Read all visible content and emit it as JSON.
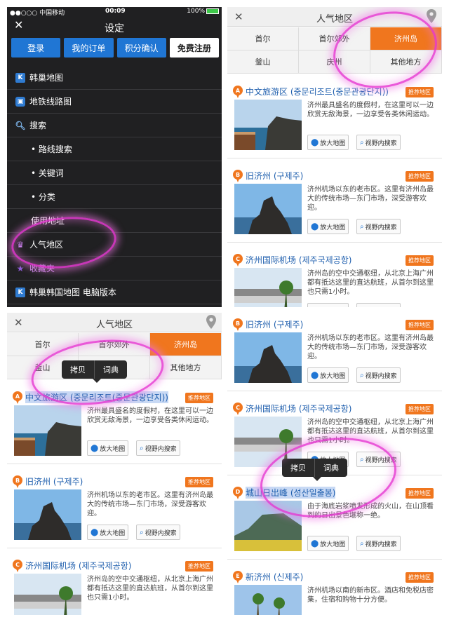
{
  "colors": {
    "accent": "#f0761e",
    "primary_button": "#2076d4",
    "link": "#1f5fae",
    "highlight": "#e63cd2"
  },
  "menu_screen": {
    "status": {
      "carrier": "●●○○○ 中国移动",
      "time": "00:09",
      "battery": "100%"
    },
    "title": "设定",
    "buttons": [
      "登录",
      "我的订单",
      "积分确认",
      "免费注册"
    ],
    "items": [
      {
        "label": "韩巢地图",
        "icon": "k-logo-icon"
      },
      {
        "label": "地铁线路图",
        "icon": "subway-icon"
      },
      {
        "label": "搜索",
        "icon": "search-icon"
      },
      {
        "label": "• 路线搜索",
        "icon": ""
      },
      {
        "label": "• 关键词",
        "icon": ""
      },
      {
        "label": "• 分类",
        "icon": ""
      },
      {
        "label": "使用地址",
        "icon": ""
      },
      {
        "label": "人气地区",
        "icon": "crown-icon"
      },
      {
        "label": "收藏夹",
        "icon": "star-icon"
      },
      {
        "label": "韩巢韩国地图 电脑版本",
        "icon": "k-logo-icon"
      }
    ]
  },
  "list_screen": {
    "title": "人气地区",
    "tabs": [
      [
        "首尔",
        "首尔郊外",
        "济州岛"
      ],
      [
        "釜山",
        "庆州",
        "其他地方"
      ]
    ],
    "badge": "推荐地区",
    "btn_map": "放大地图",
    "btn_search": "视野内搜索",
    "places": [
      {
        "letter": "A",
        "name": "中文旅游区 (중문리조트(중문관광단지))",
        "desc": "济州最具盛名的度假村，在这里可以一边欣赏无敌海景，一边享受各类休闲运动。"
      },
      {
        "letter": "B",
        "name": "旧济州 (구제주)",
        "desc": "济州机场以东的老市区。这里有济州岛最大的传统市场—东门市场，深受游客欢迎。"
      },
      {
        "letter": "C",
        "name": "济州国际机场 (제주국제공항)",
        "desc": "济州岛的空中交通枢纽，从北京上海广州都有抵达这里的直达航班，从首尔到这里也只需1小时。"
      },
      {
        "letter": "D",
        "name": "城山日出峰 (성산일출봉)",
        "desc": "由于海底岩浆喷发形成的火山，在山顶看到的日出景色堪称一绝。"
      },
      {
        "letter": "E",
        "name": "新济州 (신제주)",
        "desc": "济州机场以南的新市区。酒店和免税店密集，住宿和购物十分方便。"
      }
    ],
    "copy_menu": [
      "拷贝",
      "词典"
    ]
  }
}
